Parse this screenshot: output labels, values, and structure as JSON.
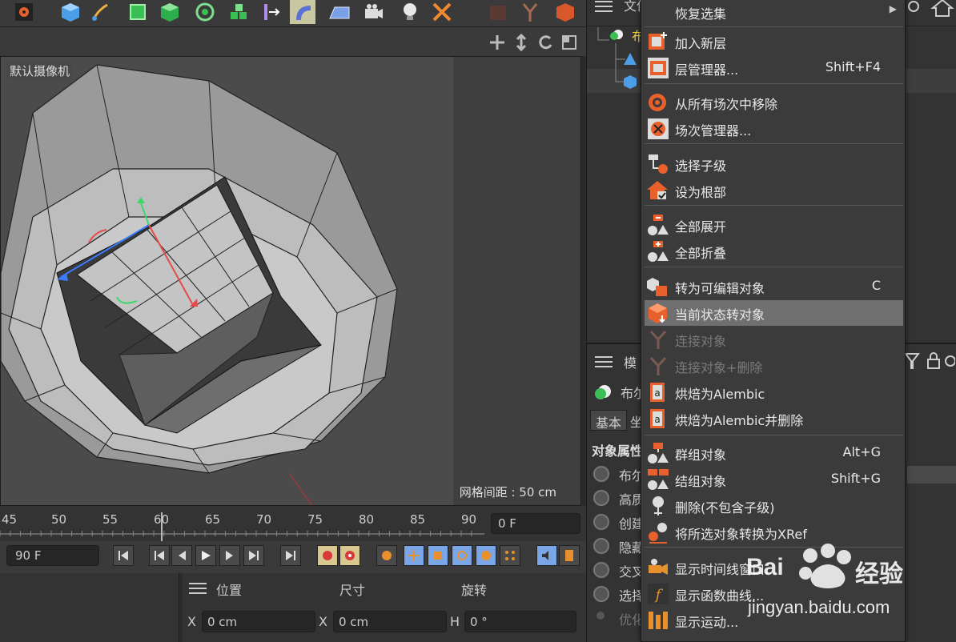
{
  "viewport": {
    "camera_label": "默认摄像机",
    "grid_label": "网格间距 : 50 cm"
  },
  "timeline": {
    "ticks": [
      "45",
      "50",
      "55",
      "60",
      "65",
      "70",
      "75",
      "80",
      "85",
      "90"
    ],
    "current_frame": "0 F",
    "end_frame": "90 F"
  },
  "coords": {
    "headers": {
      "position": "位置",
      "size": "尺寸",
      "rotation": "旋转"
    },
    "x_label": "X",
    "h_label": "H",
    "pos_x": "0 cm",
    "size_x": "0 cm",
    "rot_h": "0 °"
  },
  "object_manager": {
    "menu_label": "文件",
    "object_prefix": "布"
  },
  "attribute_manager": {
    "menu_label": "模",
    "object_prefix": "布尔",
    "tab_basic": "基本",
    "tab_coord": "坐",
    "section": "对象属性",
    "rows": [
      "布尔",
      "高质",
      "创建",
      "隐藏",
      "交叉",
      "选择",
      "优化"
    ]
  },
  "context_menu": {
    "items": [
      {
        "label": "恢复选集",
        "shortcut": "",
        "submenu": true,
        "disabled": false,
        "icon": "blank"
      },
      {
        "label": "加入新层",
        "shortcut": "",
        "disabled": false,
        "icon": "add-layer-icon"
      },
      {
        "label": "层管理器...",
        "shortcut": "Shift+F4",
        "disabled": false,
        "icon": "layer-manager-icon"
      },
      {
        "label": "从所有场次中移除",
        "shortcut": "",
        "disabled": false,
        "icon": "remove-take-icon"
      },
      {
        "label": "场次管理器...",
        "shortcut": "",
        "disabled": false,
        "icon": "take-manager-icon"
      },
      {
        "label": "选择子级",
        "shortcut": "",
        "disabled": false,
        "icon": "select-children-icon"
      },
      {
        "label": "设为根部",
        "shortcut": "",
        "disabled": false,
        "icon": "set-root-icon"
      },
      {
        "label": "全部展开",
        "shortcut": "",
        "disabled": false,
        "icon": "expand-all-icon"
      },
      {
        "label": "全部折叠",
        "shortcut": "",
        "disabled": false,
        "icon": "collapse-all-icon"
      },
      {
        "label": "转为可编辑对象",
        "shortcut": "C",
        "disabled": false,
        "icon": "make-editable-icon"
      },
      {
        "label": "当前状态转对象",
        "shortcut": "",
        "disabled": false,
        "icon": "current-state-icon",
        "highlight": true
      },
      {
        "label": "连接对象",
        "shortcut": "",
        "disabled": true,
        "icon": "connect-icon"
      },
      {
        "label": "连接对象+删除",
        "shortcut": "",
        "disabled": true,
        "icon": "connect-delete-icon"
      },
      {
        "label": "烘焙为Alembic",
        "shortcut": "",
        "disabled": false,
        "icon": "alembic-icon"
      },
      {
        "label": "烘焙为Alembic并删除",
        "shortcut": "",
        "disabled": false,
        "icon": "alembic-delete-icon"
      },
      {
        "label": "群组对象",
        "shortcut": "Alt+G",
        "disabled": false,
        "icon": "group-icon"
      },
      {
        "label": "结组对象",
        "shortcut": "Shift+G",
        "disabled": false,
        "icon": "ungroup-icon"
      },
      {
        "label": "删除(不包含子级)",
        "shortcut": "",
        "disabled": false,
        "icon": "delete-no-children-icon"
      },
      {
        "label": "将所选对象转换为XRef",
        "shortcut": "",
        "disabled": false,
        "icon": "xref-icon"
      },
      {
        "label": "显示时间线窗口...",
        "shortcut": "",
        "disabled": false,
        "icon": "timeline-icon"
      },
      {
        "label": "显示函数曲线...",
        "shortcut": "",
        "disabled": false,
        "icon": "fcurve-icon"
      },
      {
        "label": "显示运动...",
        "shortcut": "",
        "disabled": false,
        "icon": "motion-icon"
      }
    ]
  },
  "watermark": {
    "brand": "Bai",
    "brand_suffix": "经验",
    "url": "jingyan.baidu.com"
  }
}
